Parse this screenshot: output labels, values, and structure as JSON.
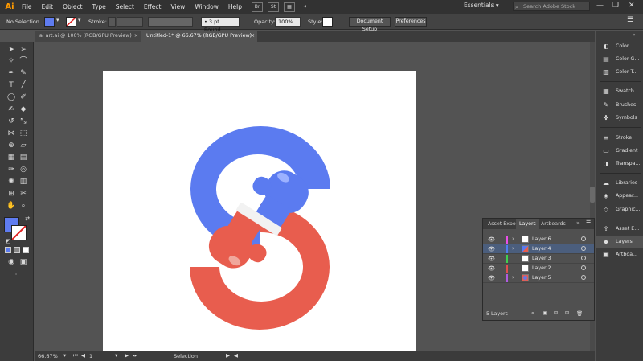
{
  "app": {
    "logo": "Ai"
  },
  "menu": [
    "File",
    "Edit",
    "Object",
    "Type",
    "Select",
    "Effect",
    "View",
    "Window",
    "Help"
  ],
  "menu_icons": [
    "Br",
    "St",
    "grid-icon",
    "feather-icon"
  ],
  "workspace": "Essentials",
  "stock_search": {
    "placeholder": "Search Adobe Stock"
  },
  "control": {
    "selection": "No Selection",
    "fill_color": "#5f7cf0",
    "stroke_label": "Stroke:",
    "brush": "3 pt. Round",
    "opacity_label": "Opacity:",
    "opacity_value": "100%",
    "style_label": "Style:",
    "document_setup": "Document Setup",
    "preferences": "Preferences"
  },
  "tabs": [
    {
      "label": "ai art.ai @ 100% (RGB/GPU Preview)",
      "close": "×"
    },
    {
      "label": "Untitled-1* @ 66.67% (RGB/GPU Preview)",
      "close": "×"
    }
  ],
  "status": {
    "zoom": "66.67%",
    "artboard": "1",
    "tool": "Selection"
  },
  "dock": [
    {
      "label": "Color",
      "icon": "color-icon"
    },
    {
      "label": "Color G...",
      "icon": "color-guide-icon"
    },
    {
      "label": "Color T...",
      "icon": "color-themes-icon"
    },
    {
      "label": "Swatch...",
      "icon": "swatches-icon"
    },
    {
      "label": "Brushes",
      "icon": "brushes-icon"
    },
    {
      "label": "Symbols",
      "icon": "symbols-icon"
    },
    {
      "label": "Stroke",
      "icon": "stroke-icon"
    },
    {
      "label": "Gradient",
      "icon": "gradient-icon"
    },
    {
      "label": "Transpa...",
      "icon": "transparency-icon"
    },
    {
      "label": "Libraries",
      "icon": "libraries-icon"
    },
    {
      "label": "Appear...",
      "icon": "appearance-icon"
    },
    {
      "label": "Graphic...",
      "icon": "graphic-styles-icon"
    },
    {
      "label": "Asset E...",
      "icon": "asset-export-icon"
    },
    {
      "label": "Layers",
      "icon": "layers-icon"
    },
    {
      "label": "Artboa...",
      "icon": "artboards-icon"
    }
  ],
  "layers_panel": {
    "tabs": [
      "Asset Expor",
      "Layers",
      "Artboards"
    ],
    "layers": [
      {
        "name": "Layer 6",
        "color": "#e94fe9"
      },
      {
        "name": "Layer 4",
        "color": "#4f7df0"
      },
      {
        "name": "Layer 3",
        "color": "#3fd04f"
      },
      {
        "name": "Layer 2",
        "color": "#e04f4f"
      },
      {
        "name": "Layer 5",
        "color": "#b05ce0"
      }
    ],
    "count": "5 Layers"
  },
  "artwork": {
    "blue": "#5b7bf0",
    "red": "#e85d4e",
    "cuff": "#f2f2f2"
  }
}
